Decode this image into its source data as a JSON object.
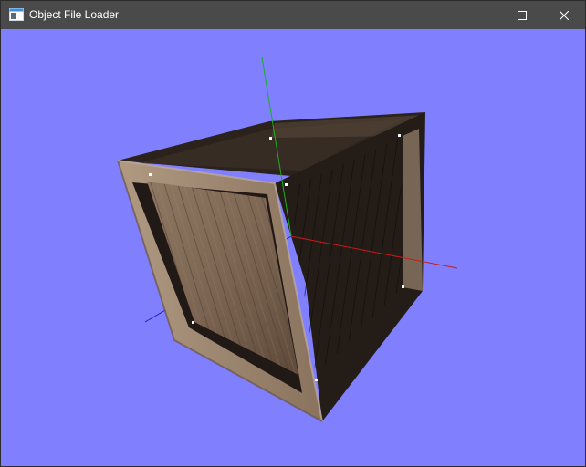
{
  "window": {
    "title": "Object File Loader",
    "controls": {
      "minimize": "minimize-icon",
      "maximize": "maximize-icon",
      "close": "close-icon"
    }
  },
  "viewport": {
    "background_color": "#8080ff",
    "object": "textured wooden crate",
    "axes": {
      "x_color": "#cc1a1a",
      "y_color": "#1ab01a",
      "z_color": "#1a1acc"
    },
    "vertex_marker_color": "#ffffff"
  }
}
